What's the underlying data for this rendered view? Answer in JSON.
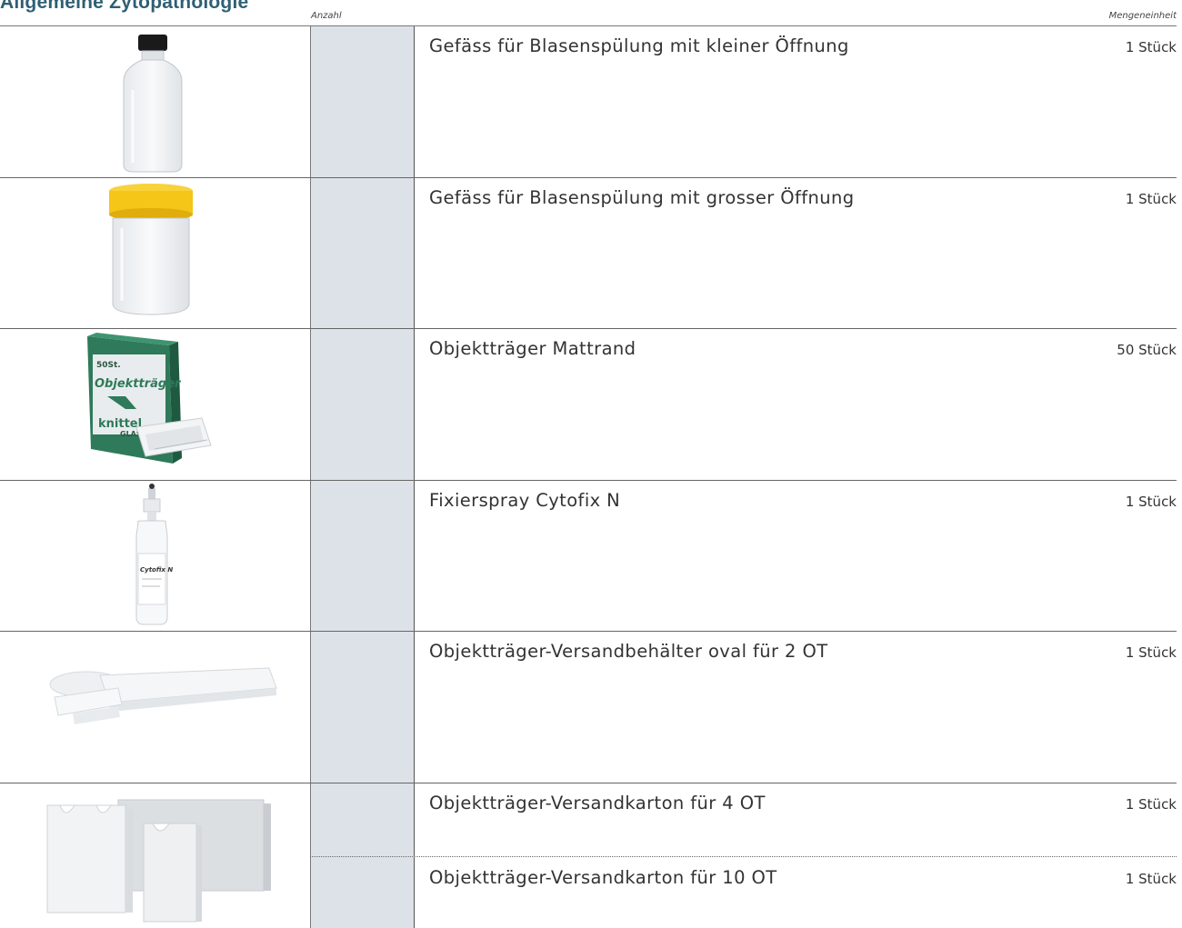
{
  "section": {
    "title": "Allgemeine Zytopathologie",
    "col_anzahl": "Anzahl",
    "col_mengeneinheit": "Mengeneinheit"
  },
  "items": [
    {
      "name": "Gefäss für Blasenspülung mit kleiner Öffnung",
      "unit": "1 Stück",
      "image_icon": "small-opening-bottle-icon"
    },
    {
      "name": "Gefäss für Blasenspülung mit grosser Öffnung",
      "unit": "1 Stück",
      "image_icon": "wide-opening-container-icon"
    },
    {
      "name": "Objektträger Mattrand",
      "unit": "50 Stück",
      "image_icon": "slide-box-icon",
      "image_text": [
        "50St.",
        "Objektträger",
        "knittel",
        "GLASS"
      ]
    },
    {
      "name": "Fixierspray Cytofix N",
      "unit": "1 Stück",
      "image_icon": "spray-bottle-icon",
      "image_text": [
        "Cytofix N"
      ]
    },
    {
      "name": "Objektträger-Versandbehälter oval für 2 OT",
      "unit": "1 Stück",
      "image_icon": "oval-slide-mailer-icon"
    },
    {
      "name": "Objektträger-Versandkarton für 4 OT",
      "unit": "1 Stück",
      "image_icon": "slide-mailer-carton-icon"
    },
    {
      "name": "Objektträger-Versandkarton für 10 OT",
      "unit": "1 Stück"
    }
  ],
  "colors": {
    "title": "#2f5f74",
    "quantity_column": "#dde2e8",
    "lid_yellow": "#f5c518"
  }
}
